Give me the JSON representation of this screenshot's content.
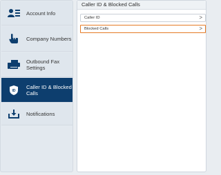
{
  "sidebar": {
    "items": [
      {
        "label": "Account Info",
        "icon": "account-card-icon",
        "active": false
      },
      {
        "label": "Company Numbers",
        "icon": "hand-pointer-icon",
        "active": false
      },
      {
        "label": "Outbound Fax Settings",
        "icon": "fax-icon",
        "active": false
      },
      {
        "label": "Caller ID & Blocked Calls",
        "icon": "shield-id-icon",
        "active": true
      },
      {
        "label": "Notifications",
        "icon": "inbox-icon",
        "active": false
      }
    ]
  },
  "panel": {
    "title": "Caller ID & Blocked Calls",
    "rows": [
      {
        "label": "Caller ID",
        "chevron": ">"
      },
      {
        "label": "Blocked Calls",
        "chevron": ">",
        "highlighted": true
      }
    ]
  },
  "colors": {
    "active_bg": "#0d3e6e",
    "highlight": "#e57a24",
    "icon_color": "#0d3e6e"
  }
}
